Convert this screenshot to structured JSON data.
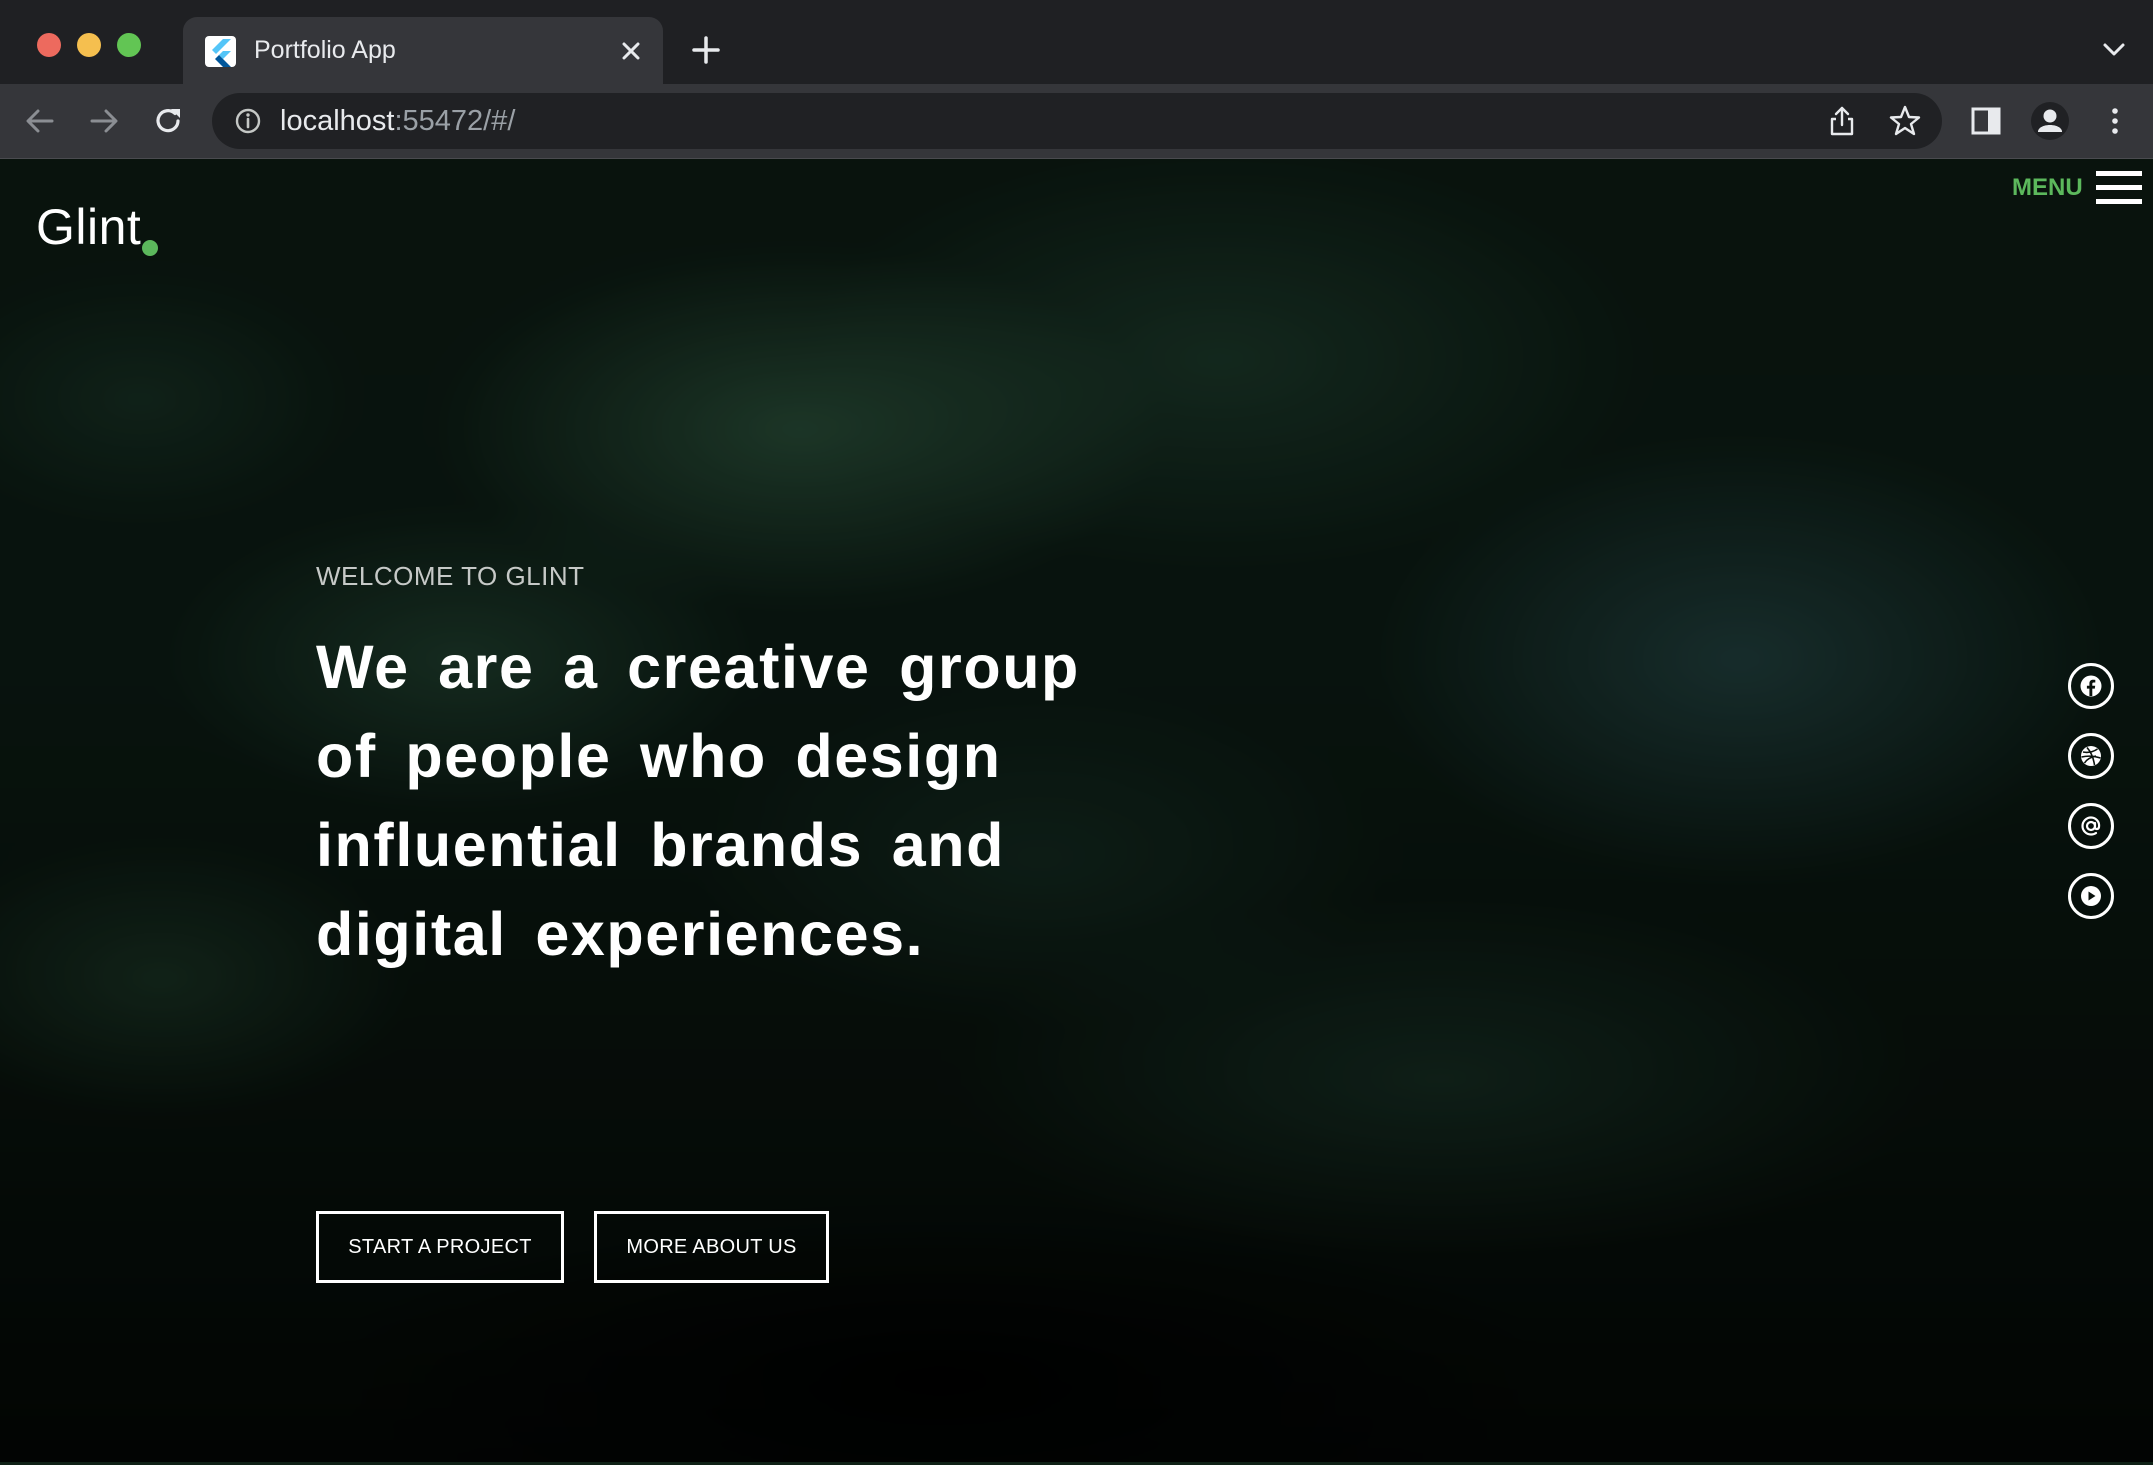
{
  "browser": {
    "tab": {
      "title": "Portfolio App",
      "favicon_icon": "flutter-logo-icon"
    },
    "address": {
      "host": "localhost",
      "rest": ":55472/#/"
    },
    "icons": {
      "back": "arrow-left-icon",
      "forward": "arrow-right-icon",
      "reload": "reload-icon",
      "info": "info-icon",
      "share": "share-icon",
      "bookmark": "star-icon",
      "side_panel": "side-panel-icon",
      "profile": "profile-icon",
      "menu": "kebab-menu-icon",
      "new_tab": "plus-icon",
      "tab_close": "close-icon",
      "tab_overflow": "chevron-down-icon"
    }
  },
  "page": {
    "logo": "Glint",
    "menu_label": "MENU",
    "hero": {
      "eyebrow": "WELCOME TO GLINT",
      "headline": "We are a creative group of people who design influential brands and digital experiences.",
      "primary_button": "START A PROJECT",
      "secondary_button": "MORE ABOUT US"
    },
    "social_icons": [
      "facebook-icon",
      "dribbble-icon",
      "at-sign-icon",
      "play-circle-icon"
    ]
  },
  "colors": {
    "accent": "#5cb85c",
    "text": "#ffffff",
    "chrome_dark": "#1f2023",
    "chrome_toolbar": "#35363a",
    "omnibox": "#202124"
  }
}
